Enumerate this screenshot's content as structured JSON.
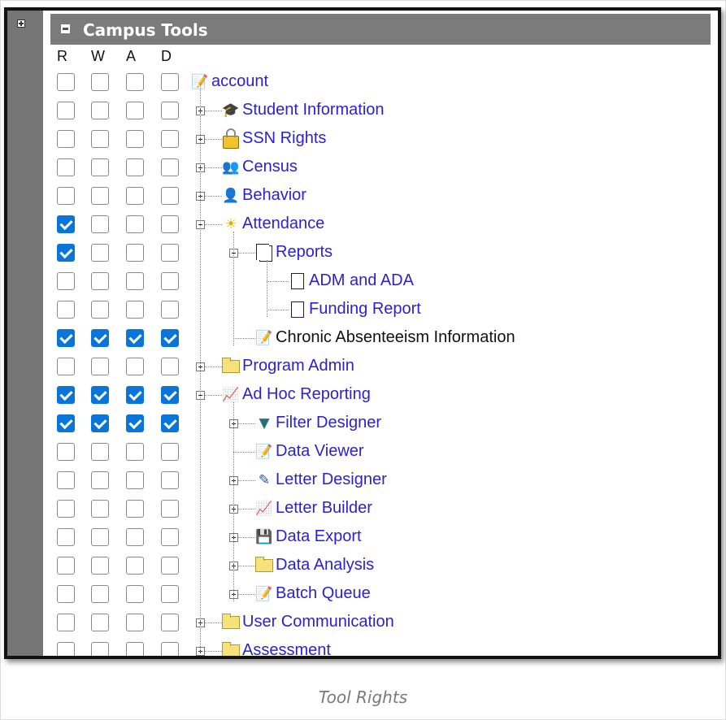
{
  "header": {
    "title": "Campus Tools"
  },
  "columns": [
    "R",
    "W",
    "A",
    "D"
  ],
  "rows": [
    {
      "label": "account",
      "icon": "edit-note-icon",
      "checks": [
        false,
        false,
        false,
        false
      ],
      "expander": "none",
      "depth": 0
    },
    {
      "label": "Student Information",
      "icon": "student-icon",
      "checks": [
        false,
        false,
        false,
        false
      ],
      "expander": "plus",
      "depth": 1
    },
    {
      "label": "SSN Rights",
      "icon": "lock-icon",
      "checks": [
        false,
        false,
        false,
        false
      ],
      "expander": "plus",
      "depth": 1
    },
    {
      "label": "Census",
      "icon": "census-icon",
      "checks": [
        false,
        false,
        false,
        false
      ],
      "expander": "plus",
      "depth": 1
    },
    {
      "label": "Behavior",
      "icon": "behavior-icon",
      "checks": [
        false,
        false,
        false,
        false
      ],
      "expander": "plus",
      "depth": 1
    },
    {
      "label": "Attendance",
      "icon": "bell-icon",
      "checks": [
        true,
        false,
        false,
        false
      ],
      "expander": "minus",
      "depth": 1
    },
    {
      "label": "Reports",
      "icon": "pages-icon",
      "checks": [
        true,
        false,
        false,
        false
      ],
      "expander": "minus",
      "depth": 2
    },
    {
      "label": "ADM and ADA",
      "icon": "page-icon",
      "checks": [
        false,
        false,
        false,
        false
      ],
      "expander": "none",
      "depth": 3
    },
    {
      "label": "Funding Report",
      "icon": "page-icon",
      "checks": [
        false,
        false,
        false,
        false
      ],
      "expander": "none",
      "depth": 3
    },
    {
      "label": "Chronic Absenteeism Information",
      "icon": "edit-note-icon",
      "checks": [
        true,
        true,
        true,
        true
      ],
      "expander": "none",
      "depth": 2,
      "black": true
    },
    {
      "label": "Program Admin",
      "icon": "folder-icon",
      "checks": [
        false,
        false,
        false,
        false
      ],
      "expander": "plus",
      "depth": 1
    },
    {
      "label": "Ad Hoc Reporting",
      "icon": "report-chart-icon",
      "checks": [
        true,
        true,
        true,
        true
      ],
      "expander": "minus",
      "depth": 1
    },
    {
      "label": "Filter Designer",
      "icon": "filter-icon",
      "checks": [
        true,
        true,
        true,
        true
      ],
      "expander": "plus",
      "depth": 2
    },
    {
      "label": "Data Viewer",
      "icon": "edit-note-icon",
      "checks": [
        false,
        false,
        false,
        false
      ],
      "expander": "none",
      "depth": 2
    },
    {
      "label": "Letter Designer",
      "icon": "letter-designer-icon",
      "checks": [
        false,
        false,
        false,
        false
      ],
      "expander": "plus",
      "depth": 2
    },
    {
      "label": "Letter Builder",
      "icon": "report-chart-icon",
      "checks": [
        false,
        false,
        false,
        false
      ],
      "expander": "plus",
      "depth": 2
    },
    {
      "label": "Data Export",
      "icon": "floppy-disk-icon",
      "checks": [
        false,
        false,
        false,
        false
      ],
      "expander": "plus",
      "depth": 2
    },
    {
      "label": "Data Analysis",
      "icon": "folder-icon",
      "checks": [
        false,
        false,
        false,
        false
      ],
      "expander": "plus",
      "depth": 2
    },
    {
      "label": "Batch Queue",
      "icon": "edit-note-icon",
      "checks": [
        false,
        false,
        false,
        false
      ],
      "expander": "plus",
      "depth": 2
    },
    {
      "label": "User Communication",
      "icon": "folder-icon",
      "checks": [
        false,
        false,
        false,
        false
      ],
      "expander": "plus",
      "depth": 1
    },
    {
      "label": "Assessment",
      "icon": "folder-icon",
      "checks": [
        false,
        false,
        false,
        false
      ],
      "expander": "plus",
      "depth": 1
    }
  ],
  "caption": "Tool Rights"
}
